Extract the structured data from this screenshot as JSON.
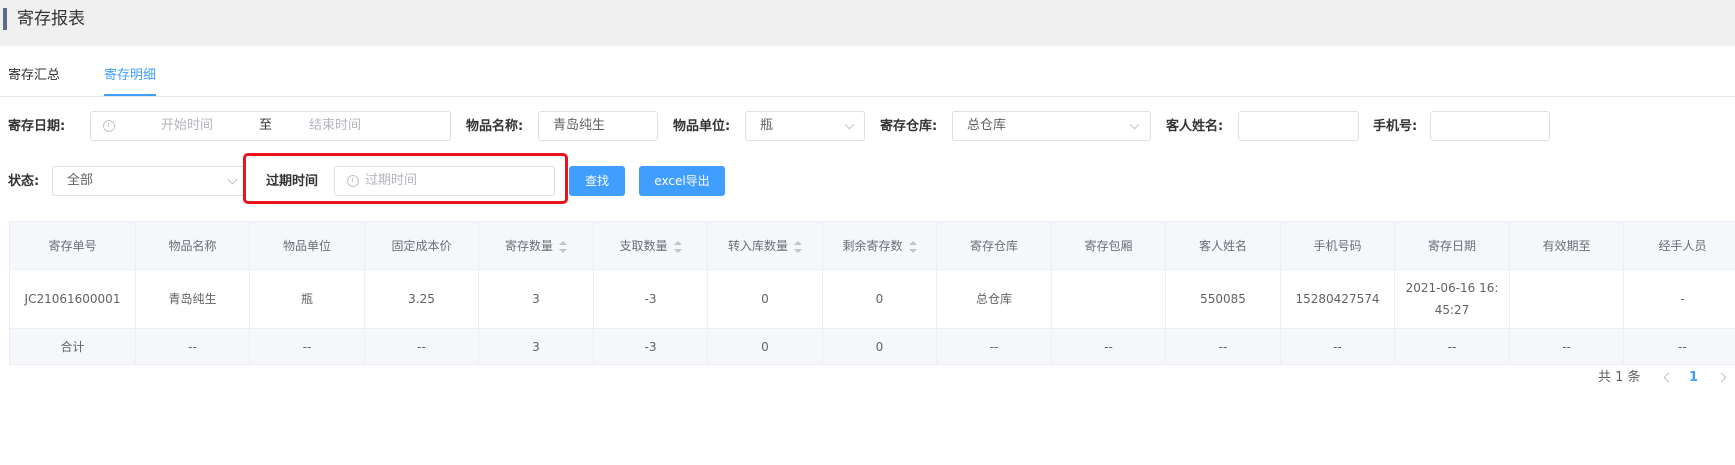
{
  "header": {
    "title": "寄存报表"
  },
  "tabs": [
    {
      "label": "寄存汇总",
      "active": false
    },
    {
      "label": "寄存明细",
      "active": true
    }
  ],
  "filters": {
    "date_label": "寄存日期:",
    "date_start_placeholder": "开始时间",
    "date_separator": "至",
    "date_end_placeholder": "结束时间",
    "item_name_label": "物品名称:",
    "item_name_value": "青岛纯生",
    "item_unit_label": "物品单位:",
    "item_unit_value": "瓶",
    "warehouse_label": "寄存仓库:",
    "warehouse_value": "总仓库",
    "guest_name_label": "客人姓名:",
    "guest_name_value": "",
    "phone_label": "手机号:",
    "phone_value": "",
    "status_label": "状态:",
    "status_value": "全部",
    "expire_label": "过期时间",
    "expire_placeholder": "过期时间"
  },
  "buttons": {
    "search": "查找",
    "export": "excel导出"
  },
  "table": {
    "columns": [
      {
        "label": "寄存单号",
        "sortable": false
      },
      {
        "label": "物品名称",
        "sortable": false
      },
      {
        "label": "物品单位",
        "sortable": false
      },
      {
        "label": "固定成本价",
        "sortable": false
      },
      {
        "label": "寄存数量",
        "sortable": true
      },
      {
        "label": "支取数量",
        "sortable": true
      },
      {
        "label": "转入库数量",
        "sortable": true
      },
      {
        "label": "剩余寄存数",
        "sortable": true
      },
      {
        "label": "寄存仓库",
        "sortable": false
      },
      {
        "label": "寄存包厢",
        "sortable": false
      },
      {
        "label": "客人姓名",
        "sortable": false
      },
      {
        "label": "手机号码",
        "sortable": false
      },
      {
        "label": "寄存日期",
        "sortable": false
      },
      {
        "label": "有效期至",
        "sortable": false
      },
      {
        "label": "经手人员",
        "sortable": false
      }
    ],
    "rows": [
      [
        "JC21061600001",
        "青岛纯生",
        "瓶",
        "3.25",
        "3",
        "-3",
        "0",
        "0",
        "总仓库",
        "",
        "550085",
        "15280427574",
        "2021-06-16 16:\n45:27",
        "",
        "-"
      ]
    ],
    "total_row": [
      "合计",
      "--",
      "--",
      "--",
      "3",
      "-3",
      "0",
      "0",
      "--",
      "--",
      "--",
      "--",
      "--",
      "--",
      "--"
    ]
  },
  "pagination": {
    "total_text": "共 1 条",
    "current_page": "1"
  },
  "colors": {
    "accent": "#409eff",
    "highlight": "#e8141e"
  }
}
